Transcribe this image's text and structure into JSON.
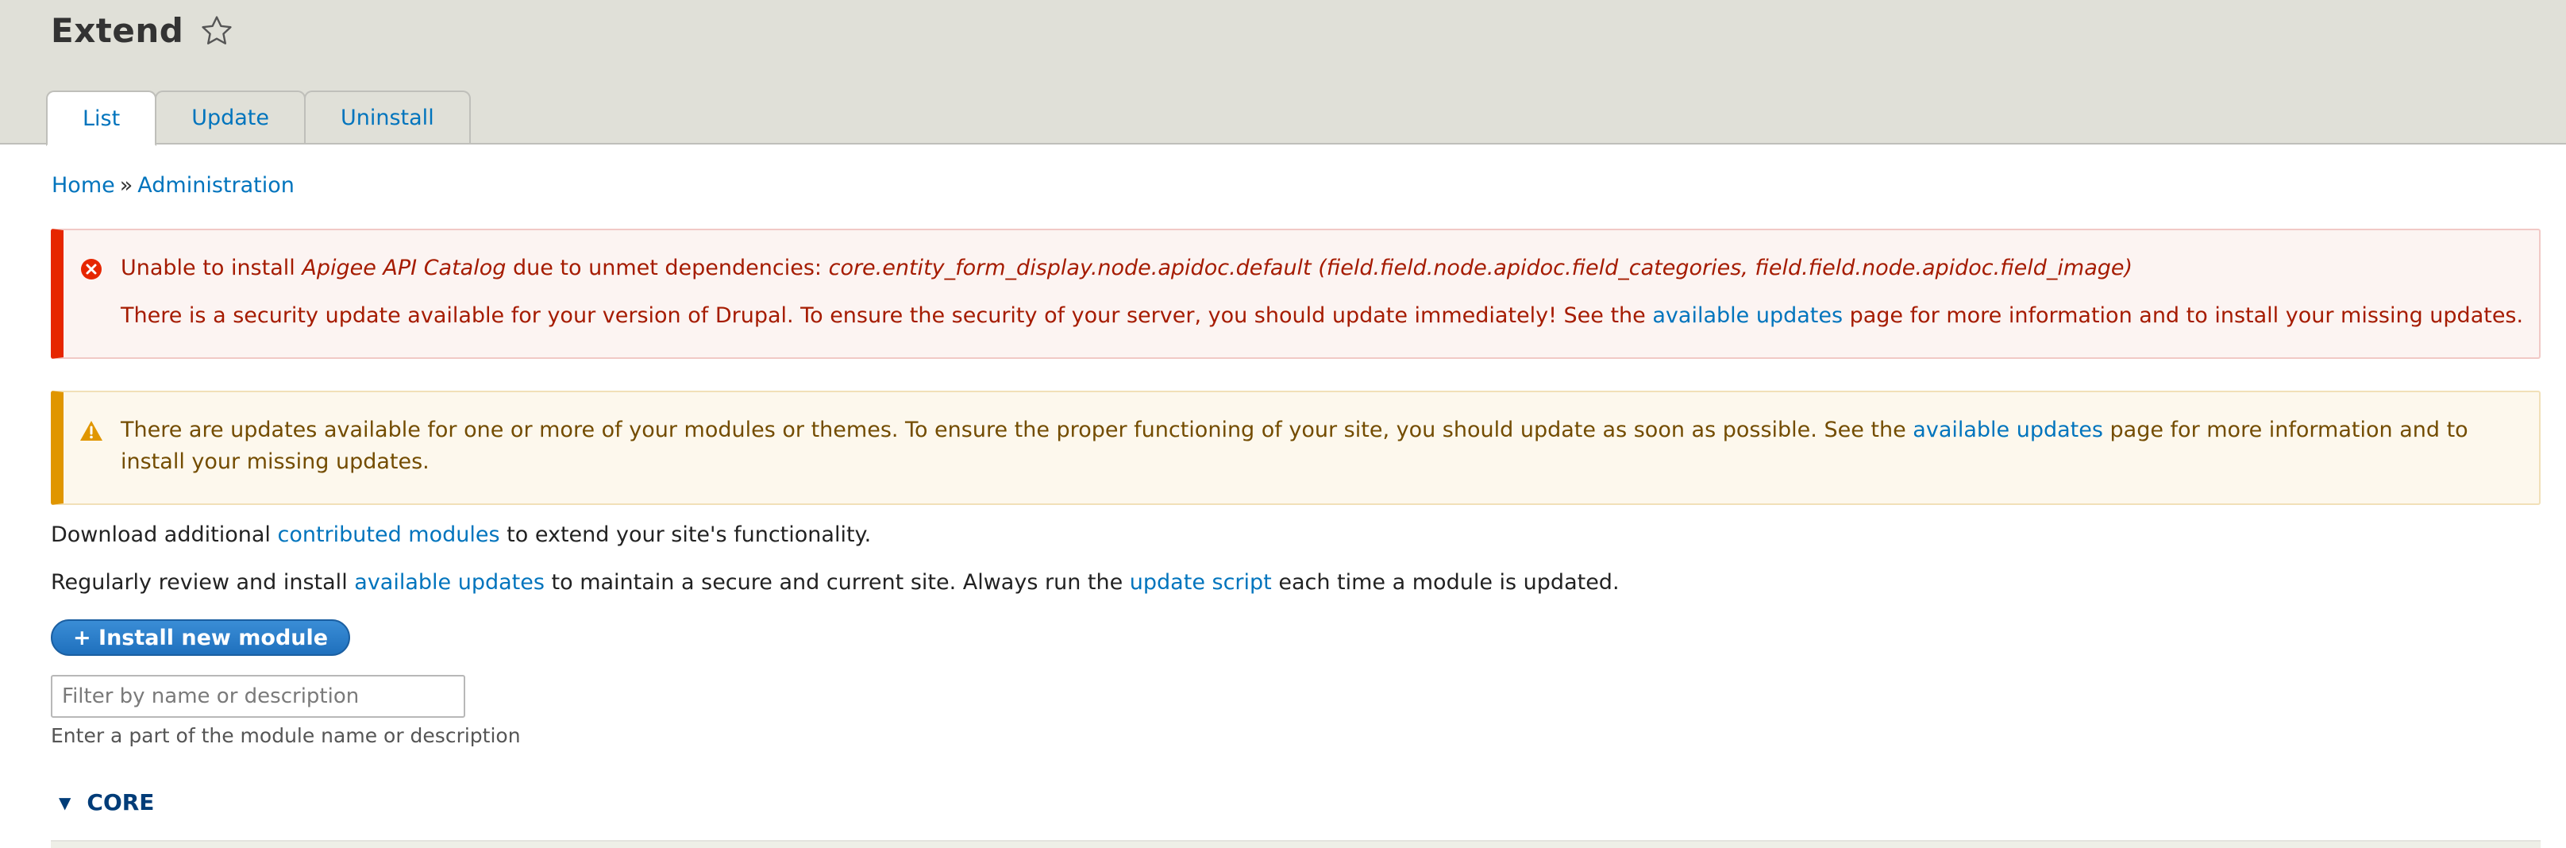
{
  "header": {
    "title": "Extend",
    "tabs": [
      {
        "label": "List",
        "active": true
      },
      {
        "label": "Update",
        "active": false
      },
      {
        "label": "Uninstall",
        "active": false
      }
    ]
  },
  "breadcrumb": {
    "items": [
      "Home",
      "Administration"
    ],
    "separator": "»"
  },
  "messages": {
    "error": {
      "icon": "error-circle-icon",
      "line1": {
        "prefix": "Unable to install ",
        "module": "Apigee API Catalog",
        "middle": " due to unmet dependencies: ",
        "deps": "core.entity_form_display.node.apidoc.default (field.field.node.apidoc.field_categories, field.field.node.apidoc.field_image)"
      },
      "line2": {
        "prefix": "There is a security update available for your version of Drupal. To ensure the security of your server, you should update immediately! See the ",
        "link": "available updates",
        "suffix": " page for more information and to install your missing updates."
      }
    },
    "warning": {
      "icon": "warning-triangle-icon",
      "prefix": "There are updates available for one or more of your modules or themes. To ensure the proper functioning of your site, you should update as soon as possible. See the ",
      "link": "available updates",
      "suffix": " page for more information and to install your missing updates."
    }
  },
  "intro": {
    "line1": {
      "prefix": "Download additional ",
      "link": "contributed modules",
      "suffix": " to extend your site's functionality."
    },
    "line2": {
      "prefix": "Regularly review and install ",
      "link1": "available updates",
      "middle": " to maintain a secure and current site. Always run the ",
      "link2": "update script",
      "suffix": " each time a module is updated."
    }
  },
  "install_button": {
    "label": "+ Install new module"
  },
  "filter": {
    "placeholder": "Filter by name or description",
    "value": "",
    "help": "Enter a part of the module name or description"
  },
  "section": {
    "label": "CORE",
    "expanded": true
  },
  "colors": {
    "link": "#0074bd",
    "error": "#e62600",
    "warning": "#e09600",
    "button": "#2a7fcf"
  }
}
